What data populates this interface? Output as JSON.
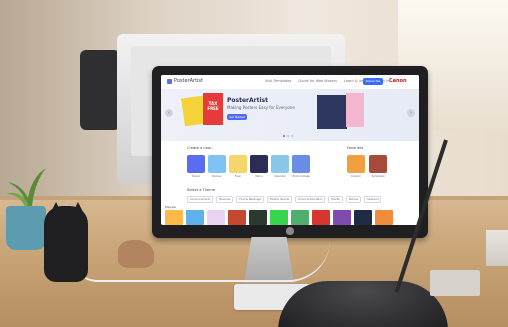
{
  "app": {
    "brand": "PosterArtist",
    "canon": "Canon",
    "topnav": [
      "Visit Templates",
      "Guide for Web Makers",
      "Learn & Inspire",
      "Sign in"
    ],
    "subscribe": "Subscribe"
  },
  "hero": {
    "title": "PosterArtist",
    "subtitle": "Making Posters Easy for Everyone",
    "cta": "Get Started",
    "poster_b_text": "TAX FREE",
    "left_arrow": "‹",
    "right_arrow": "›"
  },
  "create_section": {
    "title": "Create a new...",
    "tiles": [
      {
        "label": "Poster",
        "color": "#5a6cf0"
      },
      {
        "label": "Banner",
        "color": "#7ec3f3"
      },
      {
        "label": "Flyer",
        "color": "#f4d66a"
      },
      {
        "label": "Menu",
        "color": "#2b2d54"
      },
      {
        "label": "Calendar",
        "color": "#8ac8ea"
      },
      {
        "label": "Photo Collage",
        "color": "#6a8ee6"
      },
      {
        "label": "Custom",
        "color": "#f2a03f"
      },
      {
        "label": "Templates",
        "color": "#a84a3a"
      }
    ],
    "favorites_title": "Favorites"
  },
  "templates_section": {
    "title": "Select a Theme",
    "filters": [
      "Announcements",
      "Business",
      "Food & Beverage",
      "Holiday Special",
      "School & Education",
      "Events",
      "Notices",
      "Seasonal"
    ],
    "popular_title": "Popular",
    "posters": [
      "#ffb84a",
      "#5eb2ea",
      "#e8d3f1",
      "#c5492e",
      "#2b3a2f",
      "#39d44d",
      "#4fb06e",
      "#d6362e",
      "#7f4bb1",
      "#1f2a44",
      "#f08c3b"
    ]
  }
}
